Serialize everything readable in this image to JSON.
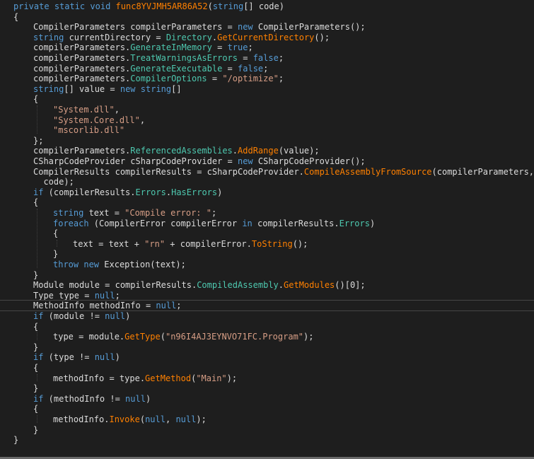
{
  "colors": {
    "background": "#1e1e1e",
    "keyword": "#569cd6",
    "identifier": "#dcdcdc",
    "member": "#4ec9b0",
    "method": "#ff8000",
    "string": "#d69d85"
  },
  "lines": [
    {
      "indent": 0,
      "tokens": [
        {
          "t": "kw",
          "v": "private"
        },
        {
          "t": "pun",
          "v": " "
        },
        {
          "t": "kw",
          "v": "static"
        },
        {
          "t": "pun",
          "v": " "
        },
        {
          "t": "kw",
          "v": "void"
        },
        {
          "t": "pun",
          "v": " "
        },
        {
          "t": "fn",
          "v": "func8YVJMH5AR86A52"
        },
        {
          "t": "pun",
          "v": "("
        },
        {
          "t": "kw",
          "v": "string"
        },
        {
          "t": "pun",
          "v": "[] code)"
        }
      ]
    },
    {
      "indent": 0,
      "tokens": [
        {
          "t": "pun",
          "v": "{"
        }
      ]
    },
    {
      "indent": 1,
      "tokens": [
        {
          "t": "ty",
          "v": "CompilerParameters compilerParameters = "
        },
        {
          "t": "kw",
          "v": "new"
        },
        {
          "t": "pun",
          "v": " CompilerParameters();"
        }
      ]
    },
    {
      "indent": 1,
      "tokens": [
        {
          "t": "kw",
          "v": "string"
        },
        {
          "t": "pun",
          "v": " currentDirectory = "
        },
        {
          "t": "mem",
          "v": "Directory"
        },
        {
          "t": "pun",
          "v": "."
        },
        {
          "t": "meth",
          "v": "GetCurrentDirectory"
        },
        {
          "t": "pun",
          "v": "();"
        }
      ]
    },
    {
      "indent": 1,
      "tokens": [
        {
          "t": "id",
          "v": "compilerParameters."
        },
        {
          "t": "mem",
          "v": "GenerateInMemory"
        },
        {
          "t": "pun",
          "v": " = "
        },
        {
          "t": "kw",
          "v": "true"
        },
        {
          "t": "pun",
          "v": ";"
        }
      ]
    },
    {
      "indent": 1,
      "tokens": [
        {
          "t": "id",
          "v": "compilerParameters."
        },
        {
          "t": "mem",
          "v": "TreatWarningsAsErrors"
        },
        {
          "t": "pun",
          "v": " = "
        },
        {
          "t": "kw",
          "v": "false"
        },
        {
          "t": "pun",
          "v": ";"
        }
      ]
    },
    {
      "indent": 1,
      "tokens": [
        {
          "t": "id",
          "v": "compilerParameters."
        },
        {
          "t": "mem",
          "v": "GenerateExecutable"
        },
        {
          "t": "pun",
          "v": " = "
        },
        {
          "t": "kw",
          "v": "false"
        },
        {
          "t": "pun",
          "v": ";"
        }
      ]
    },
    {
      "indent": 1,
      "tokens": [
        {
          "t": "id",
          "v": "compilerParameters."
        },
        {
          "t": "mem",
          "v": "CompilerOptions"
        },
        {
          "t": "pun",
          "v": " = "
        },
        {
          "t": "str",
          "v": "\"/optimize\""
        },
        {
          "t": "pun",
          "v": ";"
        }
      ]
    },
    {
      "indent": 1,
      "tokens": [
        {
          "t": "kw",
          "v": "string"
        },
        {
          "t": "pun",
          "v": "[] value = "
        },
        {
          "t": "kw",
          "v": "new"
        },
        {
          "t": "pun",
          "v": " "
        },
        {
          "t": "kw",
          "v": "string"
        },
        {
          "t": "pun",
          "v": "[]"
        }
      ]
    },
    {
      "indent": 1,
      "tokens": [
        {
          "t": "pun",
          "v": "{"
        }
      ]
    },
    {
      "indent": 2,
      "tokens": [
        {
          "t": "str",
          "v": "\"System.dll\""
        },
        {
          "t": "pun",
          "v": ","
        }
      ]
    },
    {
      "indent": 2,
      "tokens": [
        {
          "t": "str",
          "v": "\"System.Core.dll\""
        },
        {
          "t": "pun",
          "v": ","
        }
      ]
    },
    {
      "indent": 2,
      "tokens": [
        {
          "t": "str",
          "v": "\"mscorlib.dll\""
        }
      ]
    },
    {
      "indent": 1,
      "tokens": [
        {
          "t": "pun",
          "v": "};"
        }
      ]
    },
    {
      "indent": 1,
      "tokens": [
        {
          "t": "id",
          "v": "compilerParameters."
        },
        {
          "t": "mem",
          "v": "ReferencedAssemblies"
        },
        {
          "t": "pun",
          "v": "."
        },
        {
          "t": "meth",
          "v": "AddRange"
        },
        {
          "t": "pun",
          "v": "(value);"
        }
      ]
    },
    {
      "indent": 1,
      "tokens": [
        {
          "t": "ty",
          "v": "CSharpCodeProvider cSharpCodeProvider = "
        },
        {
          "t": "kw",
          "v": "new"
        },
        {
          "t": "pun",
          "v": " CSharpCodeProvider();"
        }
      ]
    },
    {
      "indent": 1,
      "tokens": [
        {
          "t": "ty",
          "v": "CompilerResults compilerResults = cSharpCodeProvider."
        },
        {
          "t": "meth",
          "v": "CompileAssemblyFromSource"
        },
        {
          "t": "pun",
          "v": "(compilerParameters,"
        }
      ]
    },
    {
      "indent": 1,
      "extra": "  ",
      "tokens": [
        {
          "t": "pun",
          "v": "code);"
        }
      ]
    },
    {
      "indent": 1,
      "tokens": [
        {
          "t": "kw",
          "v": "if"
        },
        {
          "t": "pun",
          "v": " (compilerResults."
        },
        {
          "t": "mem",
          "v": "Errors"
        },
        {
          "t": "pun",
          "v": "."
        },
        {
          "t": "mem",
          "v": "HasErrors"
        },
        {
          "t": "pun",
          "v": ")"
        }
      ]
    },
    {
      "indent": 1,
      "tokens": [
        {
          "t": "pun",
          "v": "{"
        }
      ]
    },
    {
      "indent": 2,
      "tokens": [
        {
          "t": "kw",
          "v": "string"
        },
        {
          "t": "pun",
          "v": " text = "
        },
        {
          "t": "str",
          "v": "\"Compile error: \""
        },
        {
          "t": "pun",
          "v": ";"
        }
      ]
    },
    {
      "indent": 2,
      "tokens": [
        {
          "t": "kw",
          "v": "foreach"
        },
        {
          "t": "pun",
          "v": " (CompilerError compilerError "
        },
        {
          "t": "kw",
          "v": "in"
        },
        {
          "t": "pun",
          "v": " compilerResults."
        },
        {
          "t": "mem",
          "v": "Errors"
        },
        {
          "t": "pun",
          "v": ")"
        }
      ]
    },
    {
      "indent": 2,
      "tokens": [
        {
          "t": "pun",
          "v": "{"
        }
      ]
    },
    {
      "indent": 3,
      "tokens": [
        {
          "t": "id",
          "v": "text = text + "
        },
        {
          "t": "str",
          "v": "\"rn\""
        },
        {
          "t": "pun",
          "v": " + compilerError."
        },
        {
          "t": "meth",
          "v": "ToString"
        },
        {
          "t": "pun",
          "v": "();"
        }
      ]
    },
    {
      "indent": 2,
      "tokens": [
        {
          "t": "pun",
          "v": "}"
        }
      ]
    },
    {
      "indent": 2,
      "tokens": [
        {
          "t": "kw",
          "v": "throw"
        },
        {
          "t": "pun",
          "v": " "
        },
        {
          "t": "kw",
          "v": "new"
        },
        {
          "t": "pun",
          "v": " Exception(text);"
        }
      ]
    },
    {
      "indent": 1,
      "tokens": [
        {
          "t": "pun",
          "v": "}"
        }
      ]
    },
    {
      "indent": 1,
      "tokens": [
        {
          "t": "ty",
          "v": "Module module = compilerResults."
        },
        {
          "t": "mem",
          "v": "CompiledAssembly"
        },
        {
          "t": "pun",
          "v": "."
        },
        {
          "t": "meth",
          "v": "GetModules"
        },
        {
          "t": "pun",
          "v": "()[0];"
        }
      ]
    },
    {
      "indent": 1,
      "tokens": [
        {
          "t": "ty",
          "v": "Type type = "
        },
        {
          "t": "kw",
          "v": "null"
        },
        {
          "t": "pun",
          "v": ";"
        }
      ]
    },
    {
      "indent": 1,
      "current": true,
      "tokens": [
        {
          "t": "ty",
          "v": "MethodInfo methodInfo = "
        },
        {
          "t": "kw",
          "v": "null"
        },
        {
          "t": "pun",
          "v": ";"
        }
      ]
    },
    {
      "indent": 1,
      "tokens": [
        {
          "t": "kw",
          "v": "if"
        },
        {
          "t": "pun",
          "v": " (module != "
        },
        {
          "t": "kw",
          "v": "null"
        },
        {
          "t": "pun",
          "v": ")"
        }
      ]
    },
    {
      "indent": 1,
      "tokens": [
        {
          "t": "pun",
          "v": "{"
        }
      ]
    },
    {
      "indent": 2,
      "tokens": [
        {
          "t": "id",
          "v": "type = module."
        },
        {
          "t": "meth",
          "v": "GetType"
        },
        {
          "t": "pun",
          "v": "("
        },
        {
          "t": "str",
          "v": "\"n96I4AJ3EYNVO71FC.Program\""
        },
        {
          "t": "pun",
          "v": ");"
        }
      ]
    },
    {
      "indent": 1,
      "tokens": [
        {
          "t": "pun",
          "v": "}"
        }
      ]
    },
    {
      "indent": 1,
      "tokens": [
        {
          "t": "kw",
          "v": "if"
        },
        {
          "t": "pun",
          "v": " (type != "
        },
        {
          "t": "kw",
          "v": "null"
        },
        {
          "t": "pun",
          "v": ")"
        }
      ]
    },
    {
      "indent": 1,
      "tokens": [
        {
          "t": "pun",
          "v": "{"
        }
      ]
    },
    {
      "indent": 2,
      "tokens": [
        {
          "t": "id",
          "v": "methodInfo = type."
        },
        {
          "t": "meth",
          "v": "GetMethod"
        },
        {
          "t": "pun",
          "v": "("
        },
        {
          "t": "str",
          "v": "\"Main\""
        },
        {
          "t": "pun",
          "v": ");"
        }
      ]
    },
    {
      "indent": 1,
      "tokens": [
        {
          "t": "pun",
          "v": "}"
        }
      ]
    },
    {
      "indent": 1,
      "tokens": [
        {
          "t": "kw",
          "v": "if"
        },
        {
          "t": "pun",
          "v": " (methodInfo != "
        },
        {
          "t": "kw",
          "v": "null"
        },
        {
          "t": "pun",
          "v": ")"
        }
      ]
    },
    {
      "indent": 1,
      "tokens": [
        {
          "t": "pun",
          "v": "{"
        }
      ]
    },
    {
      "indent": 2,
      "tokens": [
        {
          "t": "id",
          "v": "methodInfo."
        },
        {
          "t": "meth",
          "v": "Invoke"
        },
        {
          "t": "pun",
          "v": "("
        },
        {
          "t": "kw",
          "v": "null"
        },
        {
          "t": "pun",
          "v": ", "
        },
        {
          "t": "kw",
          "v": "null"
        },
        {
          "t": "pun",
          "v": ");"
        }
      ]
    },
    {
      "indent": 1,
      "tokens": [
        {
          "t": "pun",
          "v": "}"
        }
      ]
    },
    {
      "indent": 0,
      "tokens": [
        {
          "t": "pun",
          "v": "}"
        }
      ]
    }
  ]
}
